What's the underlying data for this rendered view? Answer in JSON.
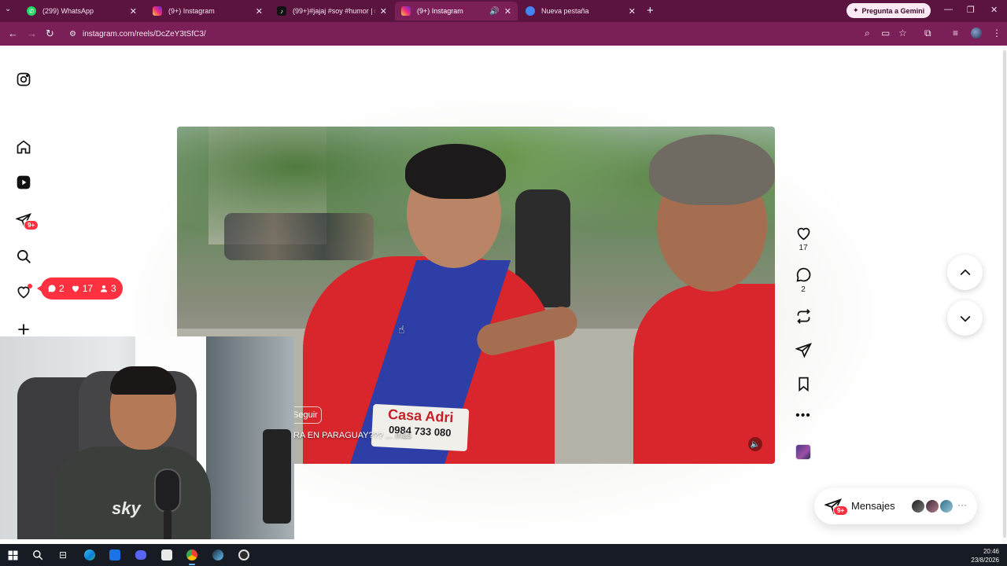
{
  "browser": {
    "tabs": [
      {
        "title": "(299) WhatsApp",
        "icon": "whatsapp-icon",
        "color": "#25d366",
        "active": false
      },
      {
        "title": "(9+) Instagram",
        "icon": "instagram-icon",
        "color": "#e1306c",
        "active": false
      },
      {
        "title": "(99+)#jajaj #soy #humor | no li",
        "icon": "tiktok-icon",
        "color": "#111111",
        "active": false
      },
      {
        "title": "(9+) Instagram",
        "icon": "instagram-icon",
        "color": "#e1306c",
        "active": true
      },
      {
        "title": "Nueva pestaña",
        "icon": "chrome-icon",
        "color": "#4285f4",
        "active": false
      }
    ],
    "gemini_label": "Pregunta a Gemini",
    "url": "instagram.com/reels/DcZeY3tSfC3/"
  },
  "sidebar": {
    "messages_badge": "9+",
    "notification_pill": {
      "comments": "2",
      "likes": "17",
      "followers": "3"
    }
  },
  "reel": {
    "follow_label": "Seguir",
    "caption": "RA EN PARAGUAY???",
    "caption_more": "... más",
    "sponsor_name": "Casa Adri",
    "sponsor_phone": "0984 733 080",
    "likes": "17",
    "comments": "2"
  },
  "messages_bar": {
    "label": "Mensajes",
    "badge": "9+"
  },
  "webcam": {
    "shirt_text": "sky"
  },
  "taskbar": {
    "time": "20:46",
    "date": "23/8/2026"
  },
  "colors": {
    "tab_bar": "#5b1340",
    "address_bar": "#7a1f57",
    "badge_red": "#ff3040",
    "taskbar": "#161b24"
  }
}
